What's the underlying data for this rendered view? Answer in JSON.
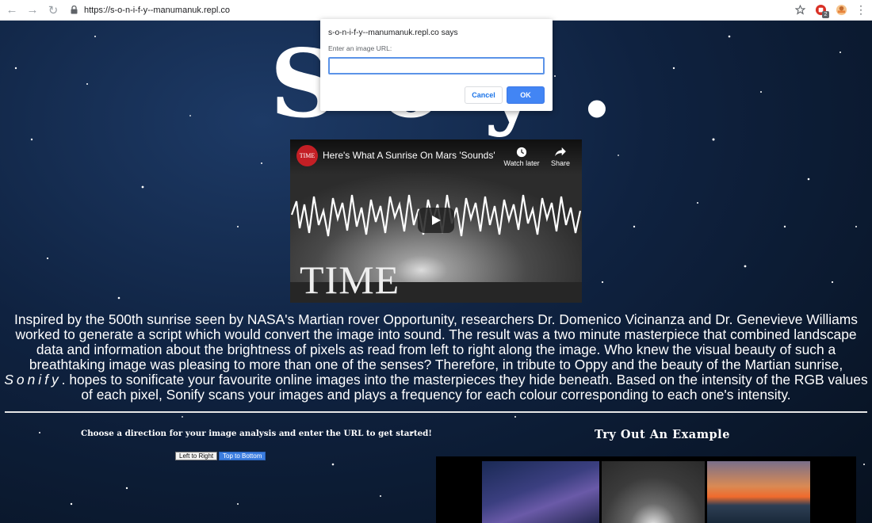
{
  "browser": {
    "url": "https://s-o-n-i-f-y--manumanuk.repl.co",
    "back_icon": "arrow-left-icon",
    "forward_icon": "arrow-right-icon",
    "reload_icon": "reload-icon",
    "lock_icon": "lock-icon",
    "star_icon": "star-icon",
    "extension_badge": "2",
    "menu_icon": "three-dots-icon"
  },
  "hero": {
    "title": "S o   y ."
  },
  "video": {
    "channel": "TIME",
    "title": "Here's What A Sunrise On Mars 'Sounds' ...",
    "watch_later": "Watch later",
    "share": "Share",
    "overlay_logo": "TIME"
  },
  "description": {
    "part1": "Inspired by the 500th sunrise seen by NASA's Martian rover Opportunity, researchers Dr. Domenico Vicinanza and Dr. Genevieve Williams worked to generate a script which would convert the image into sound. The result was a two minute masterpiece that combined landscape data and information about the brightness of pixels as read from left to right along the image. Who knew the visual beauty of such a breathtaking image was pleasing to more than one of the senses? Therefore, in tribute to Oppy and the beauty of the Martian sunrise, ",
    "brand": "Sonify",
    "part2": ". hopes to sonificate your favourite online images into the masterpieces they hide beneath. Based on the intensity of the RGB values of each pixel, Sonify scans your images and plays a frequency for each colour corresponding to each one's intensity."
  },
  "controls": {
    "instruction": "Choose a direction for your image analysis and enter the URL to get started!",
    "left_to_right": "Left to Right",
    "top_to_bottom": "Top to Bottom"
  },
  "example": {
    "title": "Try Out An Example"
  },
  "dialog": {
    "origin": "s-o-n-i-f-y--manumanuk.repl.co says",
    "message": "Enter an image URL:",
    "input_value": "",
    "cancel": "Cancel",
    "ok": "OK"
  }
}
